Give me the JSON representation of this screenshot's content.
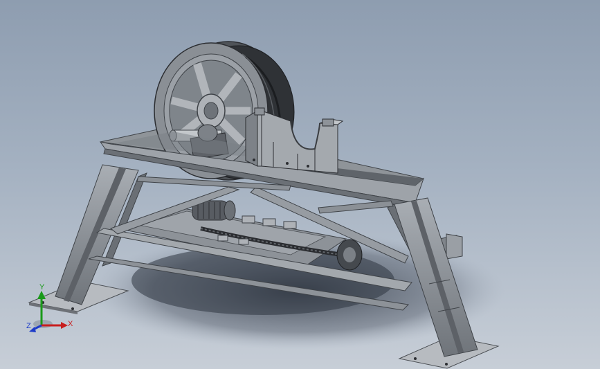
{
  "viewport": {
    "background_top": "#8e9db0",
    "background_bottom": "#c7ced7",
    "model_color": "#7d8288",
    "model_dark": "#4a4e53",
    "model_light": "#b4b8bd"
  },
  "triad": {
    "y_label": "Y",
    "x_label": "X",
    "z_label": "Z",
    "y_color": "#1a9a1a",
    "x_color": "#c81e1e",
    "z_color": "#1e3cc8"
  }
}
